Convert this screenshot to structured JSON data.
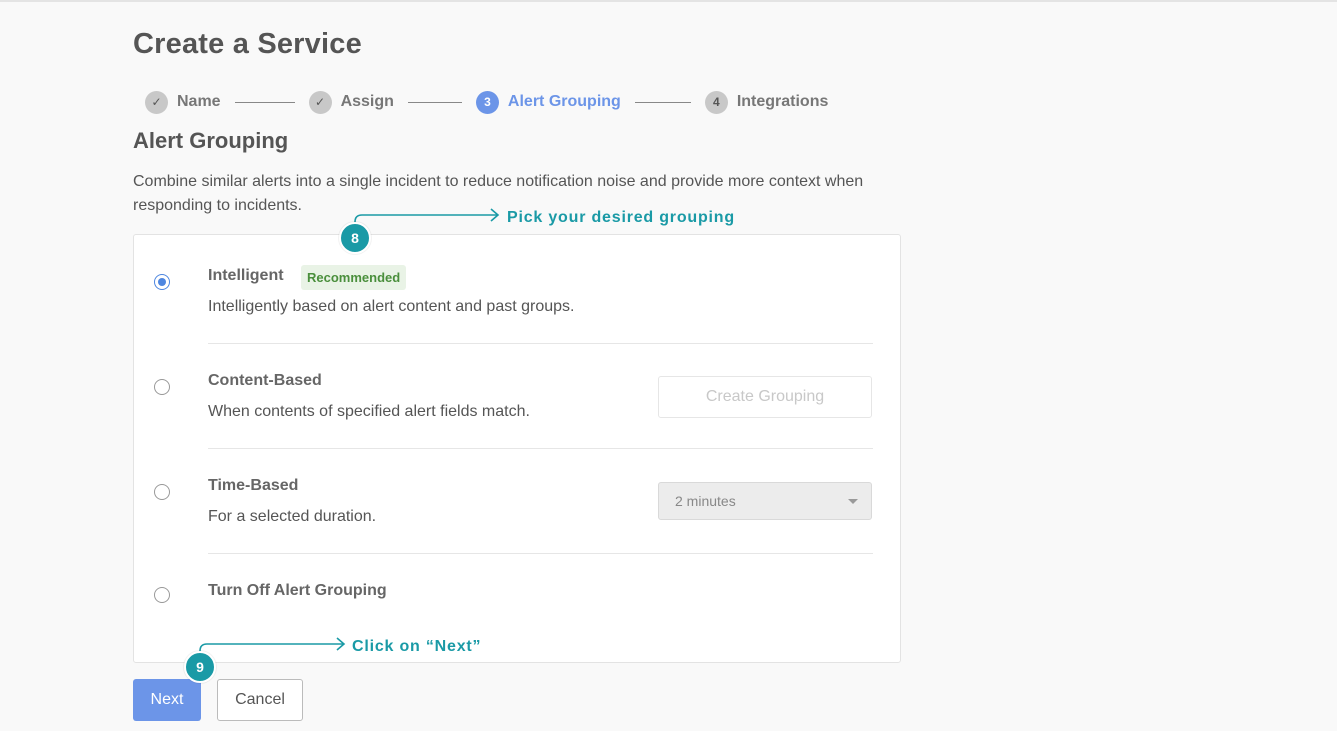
{
  "page": {
    "title": "Create a Service"
  },
  "stepper": {
    "steps": [
      {
        "marker": "✓",
        "label": "Name",
        "state": "complete"
      },
      {
        "marker": "✓",
        "label": "Assign",
        "state": "complete"
      },
      {
        "marker": "3",
        "label": "Alert Grouping",
        "state": "active"
      },
      {
        "marker": "4",
        "label": "Integrations",
        "state": "pending"
      }
    ]
  },
  "section": {
    "title": "Alert Grouping",
    "description": "Combine similar alerts into a single incident to reduce notification noise and provide more context when responding to incidents."
  },
  "options": [
    {
      "title": "Intelligent",
      "badge": "Recommended",
      "description": "Intelligently based on alert content and past groups.",
      "selected": true
    },
    {
      "title": "Content-Based",
      "description": "When contents of specified alert fields match.",
      "selected": false,
      "action_label": "Create Grouping"
    },
    {
      "title": "Time-Based",
      "description": "For a selected duration.",
      "selected": false,
      "select_value": "2 minutes"
    },
    {
      "title": "Turn Off Alert Grouping",
      "selected": false
    }
  ],
  "buttons": {
    "next_label": "Next",
    "cancel_label": "Cancel"
  },
  "annotations": [
    {
      "number": "8",
      "text": "Pick your desired grouping"
    },
    {
      "number": "9",
      "text": "Click on “Next”"
    }
  ],
  "colors": {
    "accent": "#6c95e8",
    "annotation": "#1a9aa6",
    "badge_text": "#4a8f3c",
    "badge_bg": "#e9f3e6"
  }
}
